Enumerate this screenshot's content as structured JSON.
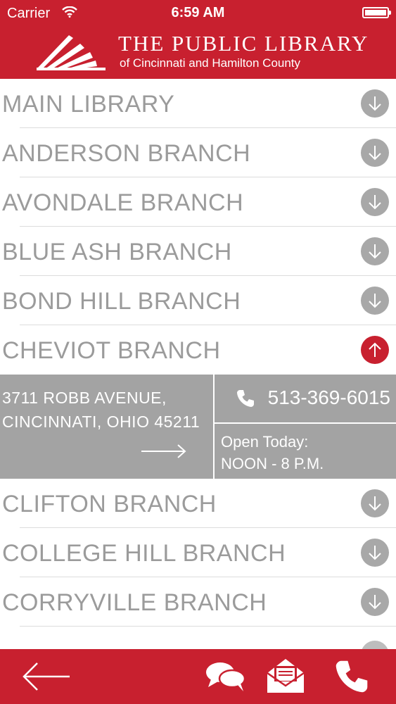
{
  "status_bar": {
    "carrier": "Carrier",
    "time": "6:59 AM"
  },
  "header": {
    "title": "THE PUBLIC LIBRARY",
    "subtitle": "of Cincinnati and Hamilton County"
  },
  "branches": [
    {
      "name": "MAIN LIBRARY",
      "expanded": false
    },
    {
      "name": "ANDERSON BRANCH",
      "expanded": false
    },
    {
      "name": "AVONDALE BRANCH",
      "expanded": false
    },
    {
      "name": "BLUE ASH BRANCH",
      "expanded": false
    },
    {
      "name": "BOND HILL BRANCH",
      "expanded": false
    },
    {
      "name": "CHEVIOT BRANCH",
      "expanded": true
    },
    {
      "name": "CLIFTON BRANCH",
      "expanded": false
    },
    {
      "name": "COLLEGE HILL BRANCH",
      "expanded": false
    },
    {
      "name": "CORRYVILLE BRANCH",
      "expanded": false
    }
  ],
  "detail": {
    "address_line1": "3711 ROBB AVENUE,",
    "address_line2": "CINCINNATI, OHIO 45211",
    "phone": "513-369-6015",
    "hours_label": "Open Today:",
    "hours_value": "NOON - 8 P.M."
  },
  "toolbar": {
    "icons": [
      "back-arrow-icon",
      "chat-icon",
      "mail-icon",
      "phone-icon"
    ]
  },
  "colors": {
    "brand_red": "#c8202f",
    "gray_text": "#9b9b9b",
    "detail_gray": "#a3a3a3",
    "toggle_gray": "#a8a8a8"
  }
}
